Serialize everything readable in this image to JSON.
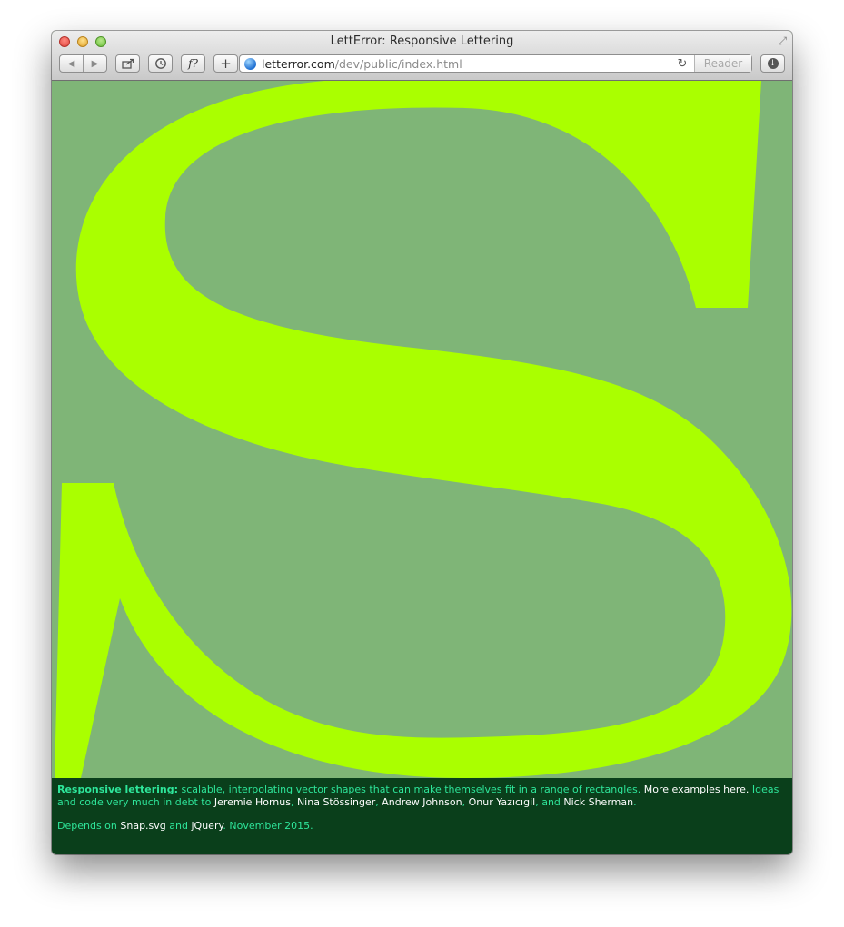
{
  "window": {
    "title": "LettError: Responsive Lettering"
  },
  "toolbar": {
    "back_glyph": "◀",
    "forward_glyph": "▶",
    "fonts_label": "f?",
    "add_glyph": "+",
    "url_host": "letterror.com",
    "url_path": "/dev/public/index.html",
    "reload_glyph": "↻",
    "reader_label": "Reader",
    "download_glyph": "↓"
  },
  "page": {
    "letter": "S",
    "colors": {
      "background": "#7fb577",
      "letter": "#aaff00",
      "footer_bg": "#0a3f1b",
      "footer_text": "#2ee59a",
      "footer_link": "#ffffff"
    }
  },
  "footer": {
    "intro_bold": "Responsive lettering:",
    "intro_text": " scalable, interpolating vector shapes that can make themselves fit in a range of rectangles.",
    "more_link": "More examples here.",
    "ideas_text": " Ideas and code very much in debt to ",
    "names": [
      "Jeremie Hornus",
      "Nina Stössinger",
      "Andrew Johnson",
      "Onur Yazıcıgil",
      "Nick Sherman"
    ],
    "sep_comma": ", ",
    "sep_and": ", and ",
    "end_period": ".",
    "depends_text": "Depends on ",
    "lib1": "Snap.svg",
    "and_text": " and ",
    "lib2": "jQuery",
    "date_text": ". November 2015."
  }
}
